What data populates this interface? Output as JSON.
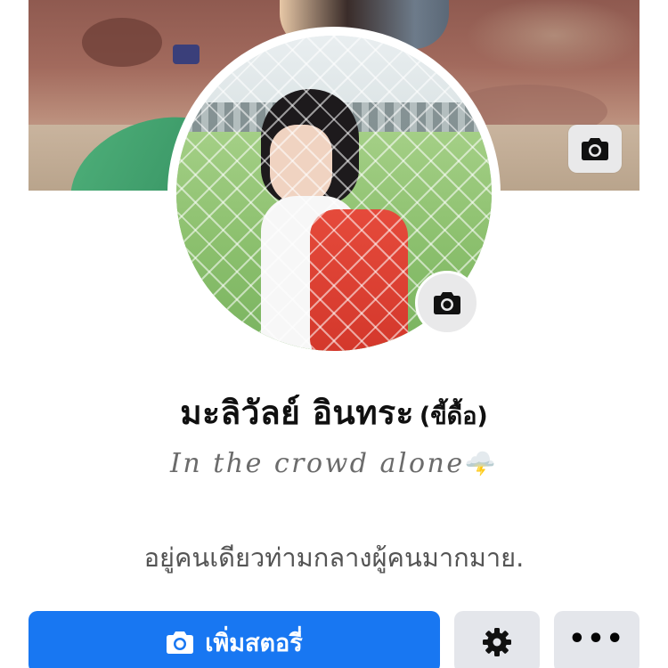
{
  "profile": {
    "name": "มะลิวัลย์ อินทระ",
    "alternate_name": "(ขี้ดื้อ)",
    "tagline": "In the crowd alone",
    "tagline_emoji": "🌩️",
    "bio": "อยู่คนเดียวท่ามกลางผู้คนมากมาย."
  },
  "actions": {
    "add_story_label": "เพิ่มสตอรี่",
    "more_label": "•••"
  },
  "icons": {
    "cover_camera": "camera-icon",
    "avatar_camera": "camera-icon",
    "story_camera": "camera-icon",
    "settings": "gear-icon",
    "more": "more-dots-icon"
  },
  "colors": {
    "primary": "#1877f2",
    "secondary_button": "#e4e6eb",
    "camera_button": "#e9e9ea",
    "name_text": "#101010",
    "bio_text": "#545454"
  }
}
